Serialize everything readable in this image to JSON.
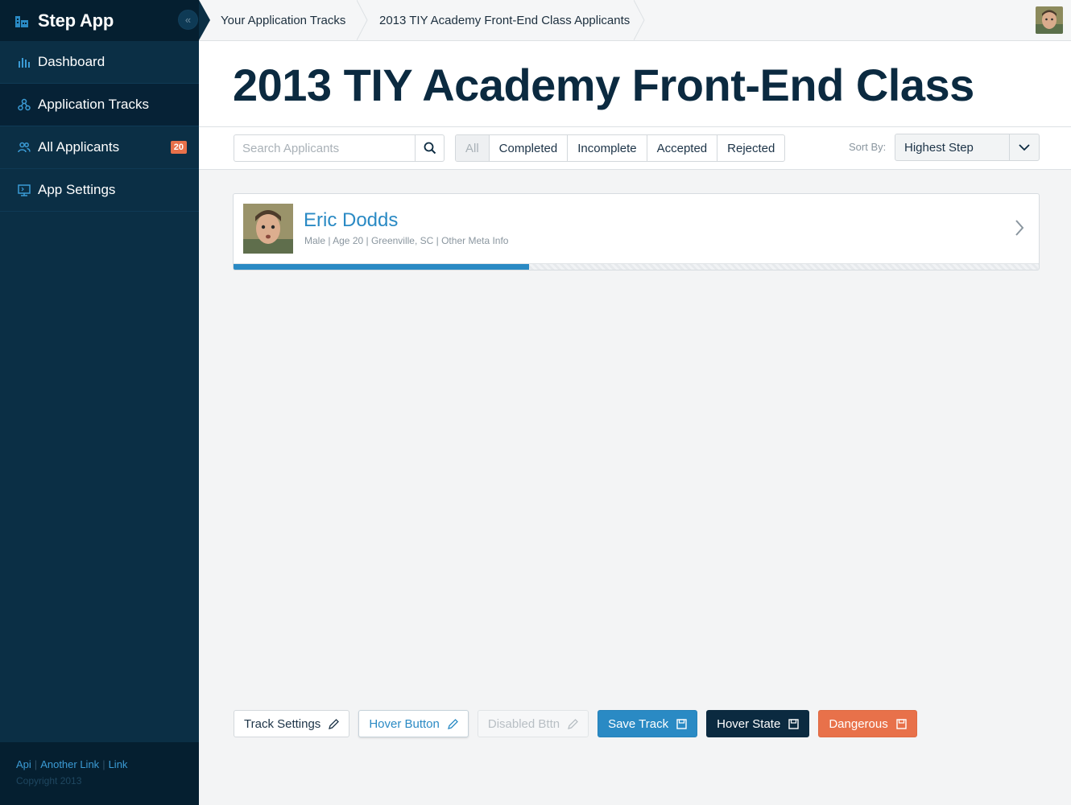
{
  "app": {
    "title": "Step App"
  },
  "sidebar": {
    "items": [
      {
        "label": "Dashboard",
        "icon": "bar-chart-icon"
      },
      {
        "label": "Application Tracks",
        "icon": "flow-icon"
      },
      {
        "label": "All Applicants",
        "icon": "users-icon",
        "badge": "20"
      },
      {
        "label": "App Settings",
        "icon": "monitor-icon"
      }
    ],
    "footer": {
      "links": [
        "Api",
        "Another Link",
        "Link"
      ],
      "copyright": "Copyright 2013"
    }
  },
  "breadcrumb": [
    "Your Application Tracks",
    "2013 TIY Academy Front-End Class Applicants"
  ],
  "page": {
    "title": "2013 TIY Academy Front-End Class"
  },
  "toolbar": {
    "search_placeholder": "Search Applicants",
    "filters": [
      "All",
      "Completed",
      "Incomplete",
      "Accepted",
      "Rejected"
    ],
    "sort_label": "Sort By:",
    "sort_value": "Highest Step"
  },
  "applicants": [
    {
      "name": "Eric Dodds",
      "meta": "Male | Age 20 | Greenville, SC | Other Meta Info",
      "progress": 0.367
    }
  ],
  "buttons": {
    "track_settings": "Track Settings",
    "hover_button": "Hover Button",
    "disabled": "Disabled Bttn",
    "save_track": "Save Track",
    "hover_state": "Hover State",
    "dangerous": "Dangerous"
  },
  "colors": {
    "sidebar_bg": "#0b2f45",
    "accent": "#2a8ac4",
    "dark": "#0b2a40",
    "danger": "#e8714a"
  }
}
